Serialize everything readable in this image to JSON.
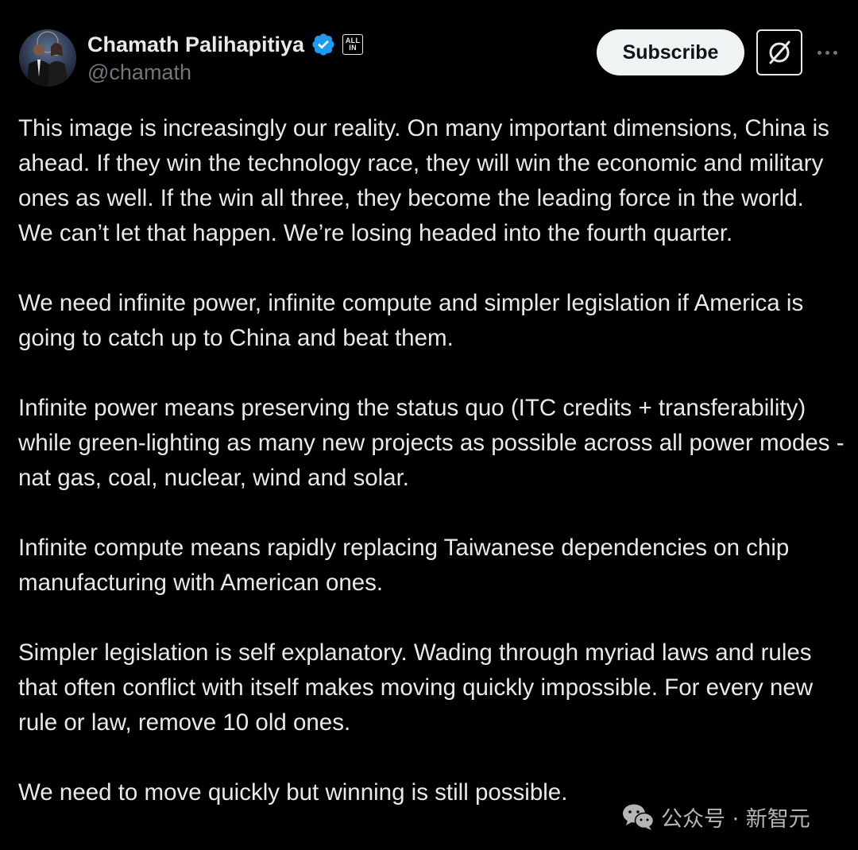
{
  "header": {
    "display_name": "Chamath Palihapitiya",
    "handle": "@chamath",
    "badge_text_line1": "ALL",
    "badge_text_line2": "IN",
    "subscribe_label": "Subscribe"
  },
  "icons": {
    "verified": "verified-badge-icon",
    "grok": "grok-icon",
    "more": "more-options-icon",
    "watermark": "wechat-icon"
  },
  "colors": {
    "background": "#000000",
    "text": "#e7e9ea",
    "muted": "#71767b",
    "verified_blue": "#1d9bf0",
    "button_bg": "#eff3f4"
  },
  "tweet": {
    "paragraphs": [
      "This image is increasingly our reality. On many important dimensions, China is ahead. If they win the technology race, they will win the economic and military ones as well. If the win all three, they become the leading force in the world. We can’t let that happen. We’re losing headed into the fourth quarter.",
      "We need infinite power, infinite compute and simpler legislation if America is going to catch up to China and beat them.",
      "Infinite power means preserving the status quo (ITC credits + transferability) while green-lighting as many new projects as possible across all power modes - nat gas, coal, nuclear, wind and solar.",
      "Infinite compute means rapidly replacing Taiwanese dependencies  on chip manufacturing with American ones.",
      "Simpler legislation is self explanatory. Wading through myriad laws and rules that often conflict with itself makes moving quickly impossible. For every new rule or law, remove 10 old ones.",
      "We need to move quickly but winning is still possible."
    ]
  },
  "watermark": {
    "text": "公众号 · 新智元"
  }
}
